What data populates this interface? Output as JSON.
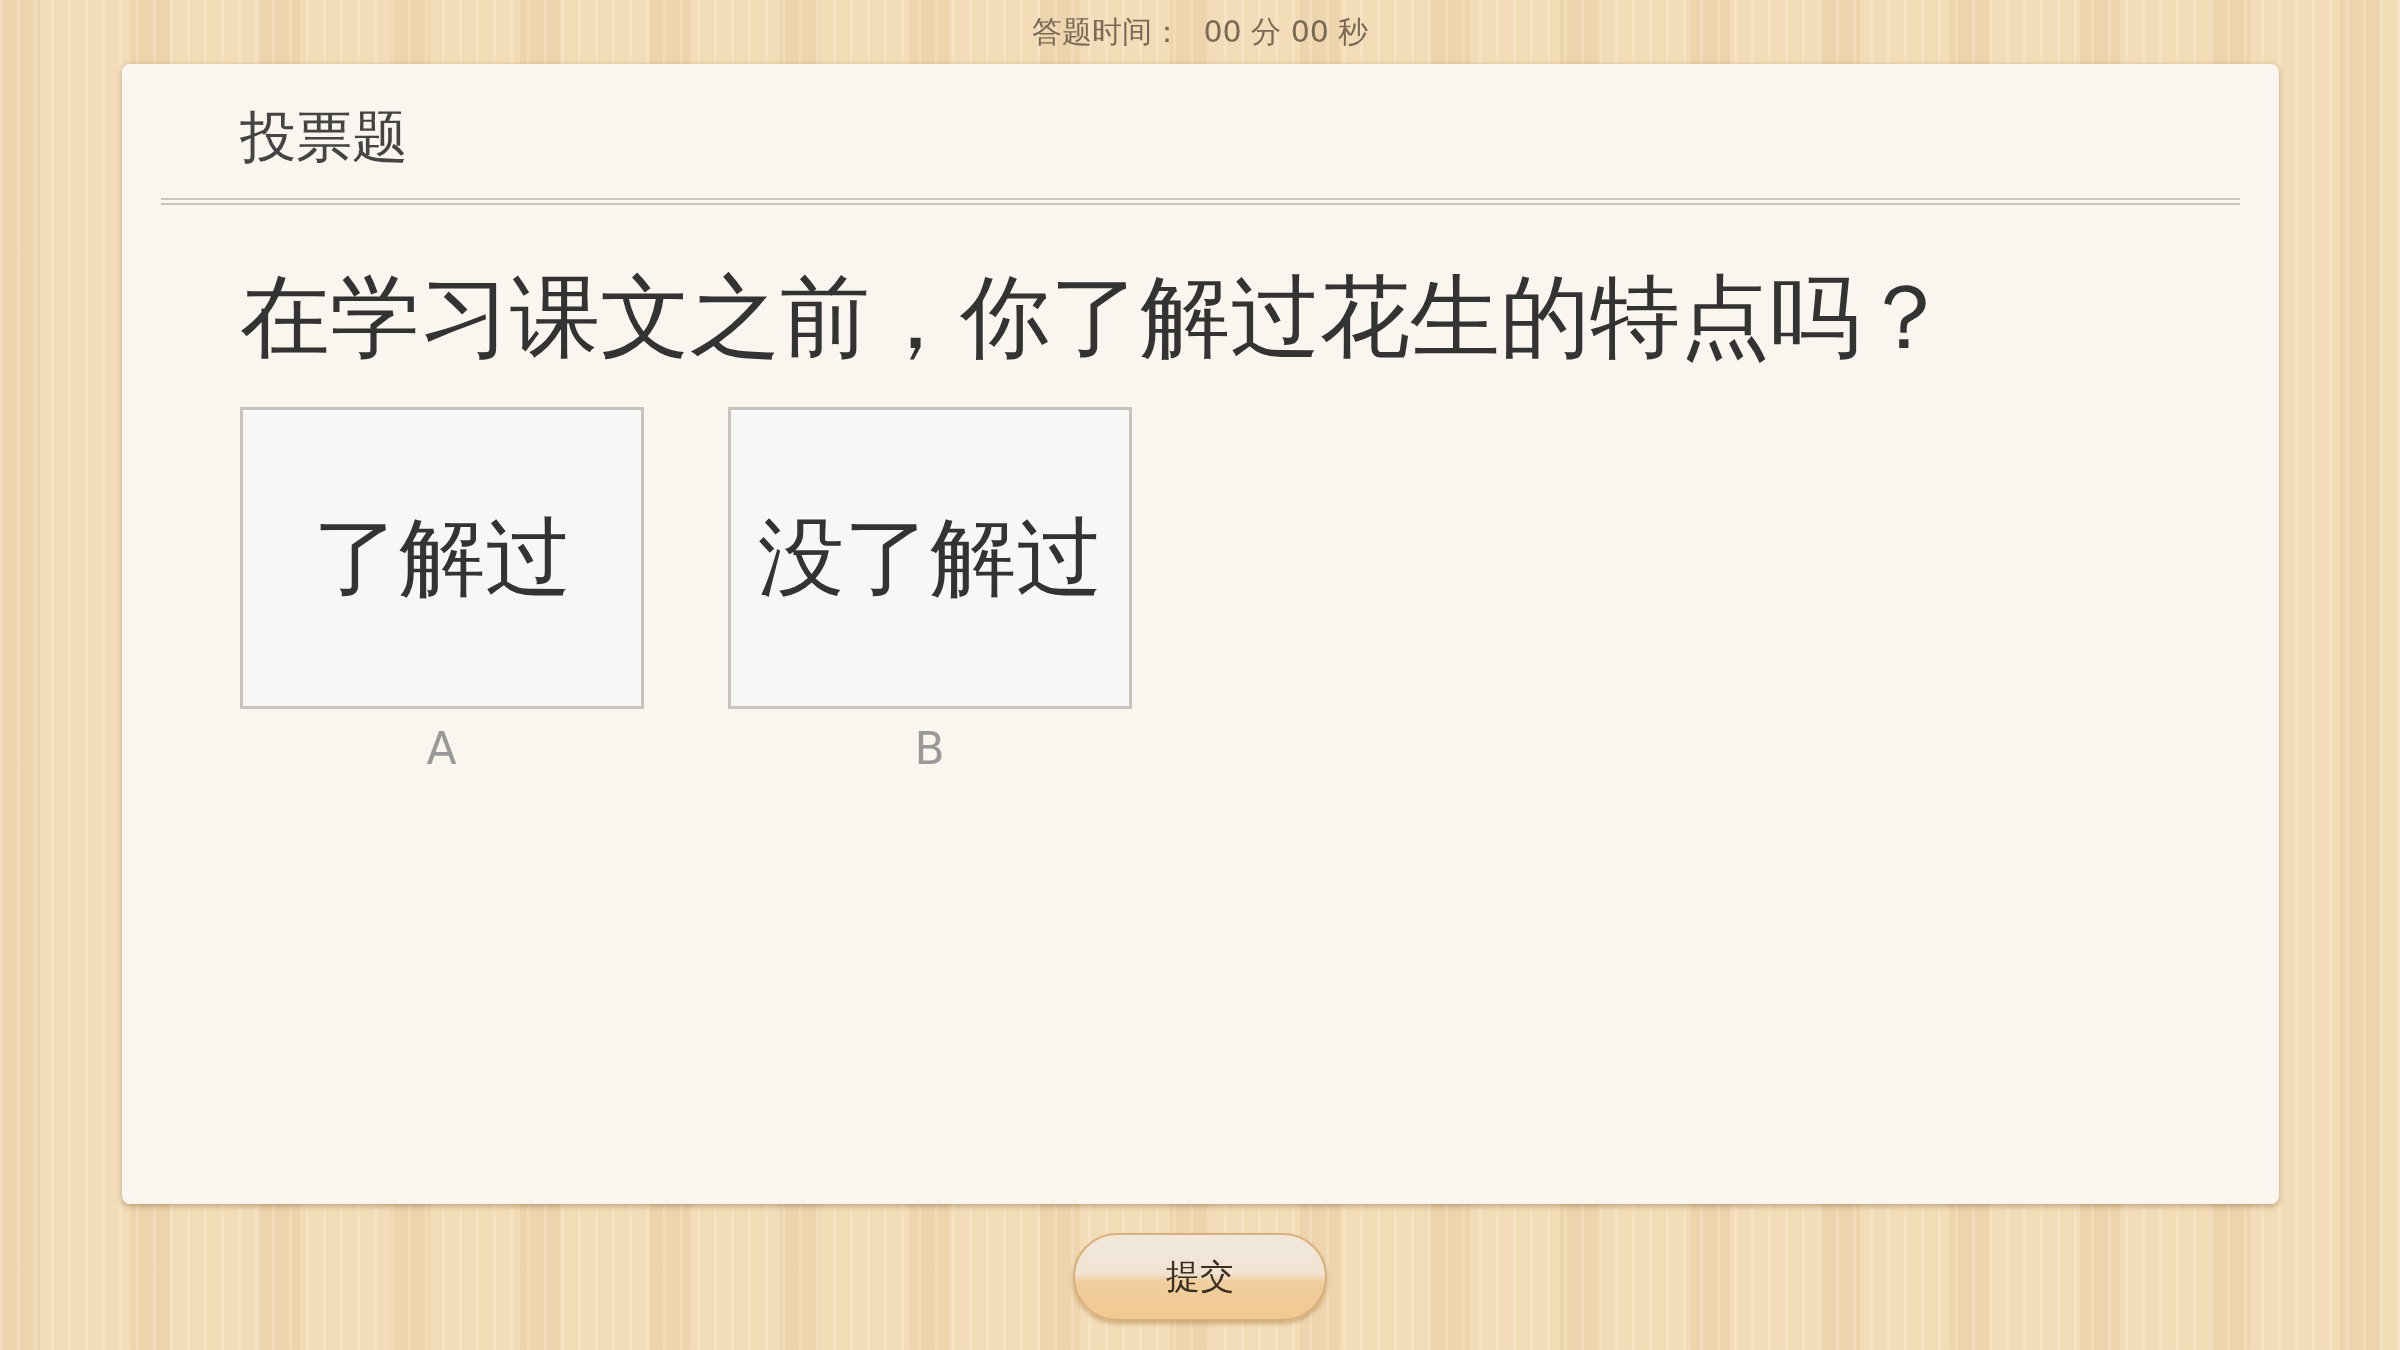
{
  "timer": {
    "label": "答题时间：",
    "value": "00 分 00 秒"
  },
  "card": {
    "title": "投票题",
    "question": "在学习课文之前，你了解过花生的特点吗？",
    "options": [
      {
        "text": "了解过",
        "letter": "A",
        "selected": false
      },
      {
        "text": "没了解过",
        "letter": "B",
        "selected": false
      }
    ]
  },
  "submit_button": "提交"
}
